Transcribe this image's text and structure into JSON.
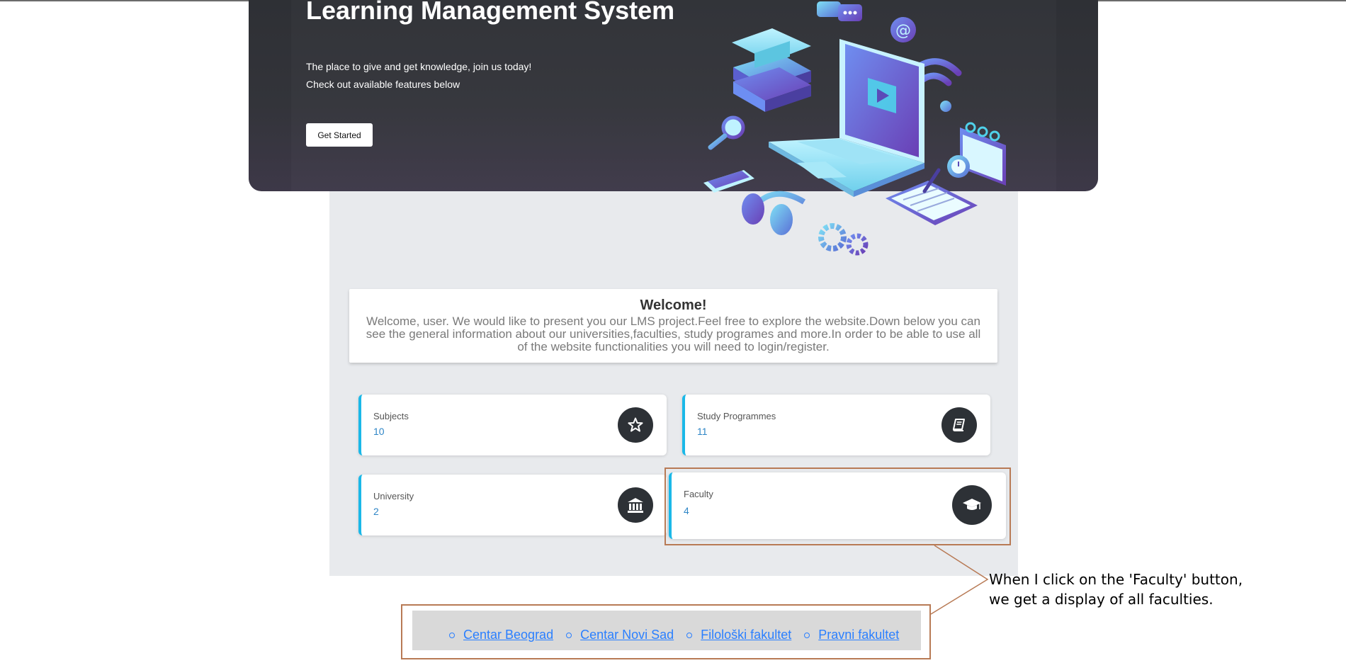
{
  "hero": {
    "title": "Learning Management System",
    "tagline": "The place to give and get knowledge, join us today!",
    "subtagline": "Check out available features below",
    "cta_label": "Get Started"
  },
  "welcome": {
    "title": "Welcome!",
    "text": "Welcome, user. We would like to present you our LMS project.Feel free to explore the website.Down below you can see the general information about our universities,faculties, study programes and more.In order to be able to use all of the website functionalities you will need to login/register."
  },
  "stats": {
    "subjects": {
      "label": "Subjects",
      "value": "10",
      "icon": "star-icon"
    },
    "study_programmes": {
      "label": "Study Programmes",
      "value": "11",
      "icon": "book-icon"
    },
    "university": {
      "label": "University",
      "value": "2",
      "icon": "bank-icon"
    },
    "faculty": {
      "label": "Faculty",
      "value": "4",
      "icon": "graduation-cap-icon"
    }
  },
  "faculties": [
    "Centar Beograd",
    "Centar Novi Sad",
    "Filološki fakultet",
    "Pravni fakultet"
  ],
  "annotation": {
    "line1": "When I click on the 'Faculty' button,",
    "line2": "we get a display of all faculties."
  },
  "colors": {
    "accent": "#1ab8e8",
    "value_text": "#2f86c6",
    "hero_bg": "#2e3035",
    "highlight_border": "#b87a55",
    "link": "#2a7fff"
  }
}
